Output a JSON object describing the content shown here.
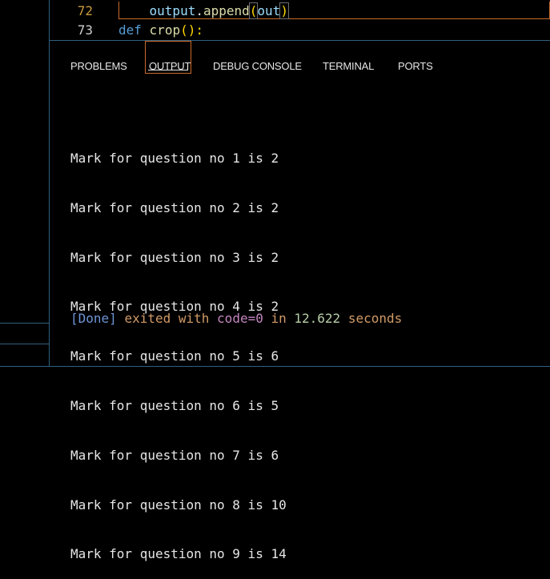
{
  "editor": {
    "lines": [
      {
        "number": "72",
        "code": {
          "indent": "    ",
          "obj": "output",
          "dot": ".",
          "method": "append",
          "open": "(",
          "arg": "out",
          "close": ")"
        }
      },
      {
        "number": "73",
        "code": {
          "kw": "def",
          "name": "crop",
          "parens": "():"
        }
      }
    ]
  },
  "panel": {
    "tabs": [
      {
        "label": "PROBLEMS"
      },
      {
        "label": "OUTPUT",
        "active": true
      },
      {
        "label": "DEBUG CONSOLE"
      },
      {
        "label": "TERMINAL"
      },
      {
        "label": "PORTS"
      }
    ]
  },
  "output": {
    "lines": [
      "Mark for question no 1 is 2",
      "Mark for question no 2 is 2",
      "Mark for question no 3 is 2",
      "Mark for question no 4 is 2",
      "Mark for question no 5 is 6",
      "Mark for question no 6 is 5",
      "Mark for question no 7 is 6",
      "Mark for question no 8 is 10",
      "Mark for question no 9 is 14"
    ],
    "done": {
      "tag": "[Done]",
      "exited": "exited with",
      "code_kw": "code=0",
      "in": "in",
      "seconds_value": "12.622",
      "seconds": "seconds"
    }
  },
  "colors": {
    "panel_border": "#2f5f7f",
    "active_tab_outline": "#c96a2a",
    "line_number_current": "#c99a3b"
  }
}
